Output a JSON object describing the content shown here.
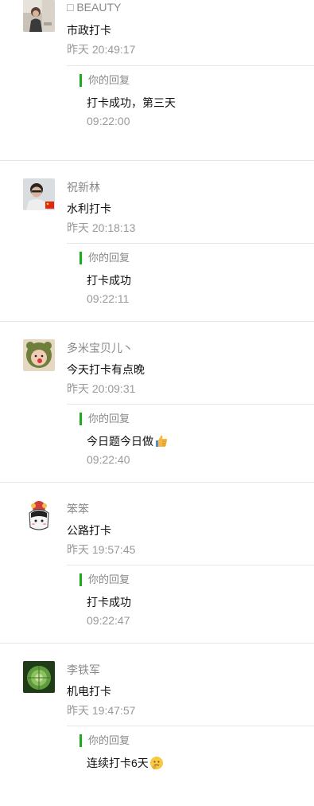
{
  "comments": [
    {
      "name": "□ BEAUTY",
      "message": "市政打卡",
      "time": "昨天 20:49:17",
      "reply_label": "你的回复",
      "reply_text": "打卡成功，第三天",
      "reply_time": "09:22:00",
      "avatar": "avatar-photo-woman-outdoor"
    },
    {
      "name": "祝新林",
      "message": "水利打卡",
      "time": "昨天 20:18:13",
      "reply_label": "你的回复",
      "reply_text": "打卡成功",
      "reply_time": "09:22:11",
      "avatar": "avatar-photo-man-flag"
    },
    {
      "name": "多米宝贝儿丶",
      "message": "今天打卡有点晚",
      "time": "昨天 20:09:31",
      "reply_label": "你的回复",
      "reply_text": "今日题今日做",
      "reply_emoji": "thumbs-up-emoji",
      "reply_time": "09:22:40",
      "avatar": "avatar-photo-child-green-hat"
    },
    {
      "name": "笨笨",
      "message": "公路打卡",
      "time": "昨天 19:57:45",
      "reply_label": "你的回复",
      "reply_text": "打卡成功",
      "reply_time": "09:22:47",
      "avatar": "avatar-cartoon-girl"
    },
    {
      "name": "李铁军",
      "message": "机电打卡",
      "time": "昨天 19:47:57",
      "reply_label": "你的回复",
      "reply_text": "连续打卡6天",
      "reply_emoji": "thinking-face-emoji",
      "reply_time": "",
      "avatar": "avatar-photo-cabbage"
    }
  ],
  "colors": {
    "reply_bar": "#1aad19",
    "name": "#888888",
    "time": "#999999",
    "divider": "#e6e6e6"
  }
}
